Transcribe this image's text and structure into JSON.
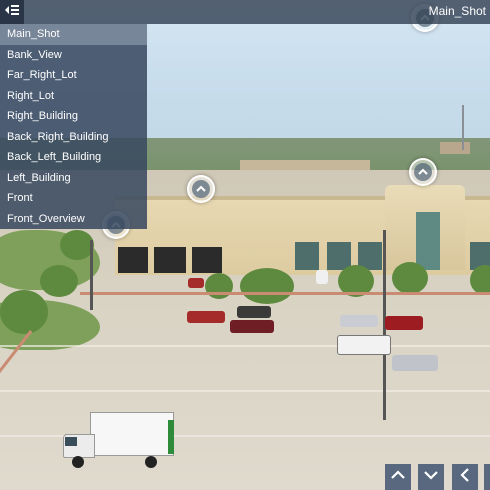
{
  "viewer": {
    "current_scene": "Main_Shot",
    "icons": {
      "menu_toggle": "menu-collapse-icon",
      "hotspot": "chevron-up-icon",
      "nav_up": "chevron-up-icon",
      "nav_down": "chevron-down-icon",
      "nav_left": "chevron-left-icon"
    }
  },
  "scene_menu": {
    "items": [
      {
        "label": "Main_Shot",
        "active": true
      },
      {
        "label": "Bank_View",
        "active": false
      },
      {
        "label": "Far_Right_Lot",
        "active": false
      },
      {
        "label": "Right_Lot",
        "active": false
      },
      {
        "label": "Right_Building",
        "active": false
      },
      {
        "label": "Back_Right_Building",
        "active": false
      },
      {
        "label": "Back_Left_Building",
        "active": false
      },
      {
        "label": "Left_Building",
        "active": false
      },
      {
        "label": "Front",
        "active": false
      },
      {
        "label": "Front_Overview",
        "active": false
      }
    ]
  }
}
